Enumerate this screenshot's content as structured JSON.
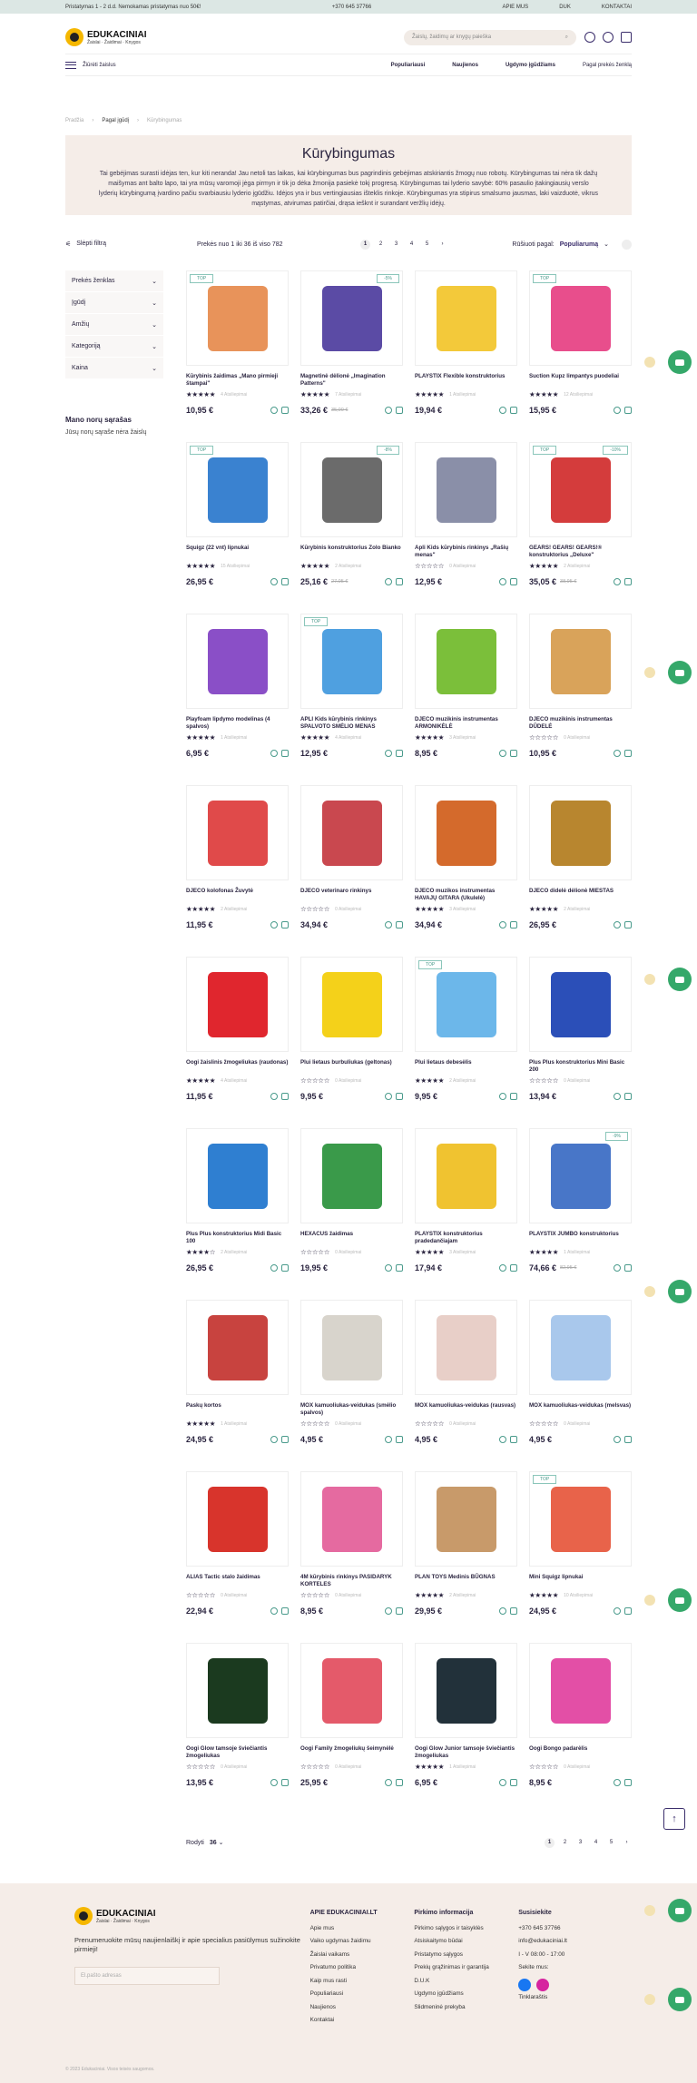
{
  "topbar": {
    "shipping": "Pristatymas 1 - 2 d.d. Nemokamas pristatymas nuo 50€!",
    "phone": "+370 645 37766",
    "links": [
      "APIE MUS",
      "DUK",
      "KONTAKTAI"
    ]
  },
  "brand": {
    "name": "EDUKACINIAI",
    "tagline": "Žaislai · Žaidimai · Knygos"
  },
  "search": {
    "placeholder": "Žaislų, žaidimų ar knygų paieška"
  },
  "nav": {
    "all": "Žiūrėti žaislus",
    "menu": [
      "Populiariausi",
      "Naujienos",
      "Ugdymo įgūdžiams",
      "Pagal prekės ženklą"
    ]
  },
  "breadcrumb": [
    "Pradžia",
    "Pagal įgūdį",
    "Kūrybingumas"
  ],
  "category": {
    "title": "Kūrybingumas",
    "description": "Tai gebėjimas surasti idėjas ten, kur kiti neranda! Jau netoli tas laikas, kai kūrybingumas bus pagrindinis gebėjimas atskiriantis žmogų nuo robotų. Kūrybingumas tai nėra tik dažų maišymas ant balto lapo, tai yra mūsų varomoji jėga pirmyn ir tik jo dėka žmonija pasiekė tokį progresą. Kūrybingumas tai lyderio savybė: 60% pasaulio įtakingiausių verslo lyderių kūrybingumą įvardino pačiu svarbiausiu lyderio įgūdžiu. Idėjos yra ir bus vertingiausias išteklis rinkoje. Kūrybingumas yra stipirus smalsumo jausmas, laki vaizduotė, vikrus mąstymas, atvirumas patirčiai, drąsa iešknt ir surandant veržlių idėjų."
  },
  "toolbar": {
    "hide": "Slėpti filtrą",
    "count": "Prekės nuo 1 iki 36 iš viso 782",
    "pages": [
      "1",
      "2",
      "3",
      "4",
      "5",
      "›"
    ],
    "sort_label": "Rūšiuoti pagal:",
    "sort_value": "Populiarumą"
  },
  "filters": [
    "Prekės ženklas",
    "Įgūdį",
    "Amžių",
    "Kategoriją",
    "Kaina"
  ],
  "wishlist": {
    "title": "Mano norų sąrašas",
    "text": "Jūsų norų sąraše nėra žaislų"
  },
  "products": [
    {
      "name": "Kūrybinis žaidimas „Mano pirmieji štampai\"",
      "stars": "★★★★★",
      "reviews": "4 Atsiliepimai",
      "price": "10,95 €",
      "old": "",
      "badge": "TOP",
      "color": "#e8935a"
    },
    {
      "name": "Magnetinė dėlionė „Imagination Patterns\"",
      "stars": "★★★★★",
      "reviews": "7 Atsiliepimai",
      "price": "33,26 €",
      "old": "35,00 €",
      "badge": "-5%",
      "color": "#5b4ba5"
    },
    {
      "name": "PLAYSTIX Flexible konstruktorius",
      "stars": "★★★★★",
      "reviews": "1 Atsiliepimai",
      "price": "19,94 €",
      "old": "",
      "badge": "",
      "color": "#f3c93a"
    },
    {
      "name": "Suction Kupz limpantys puodeliai",
      "stars": "★★★★★",
      "reviews": "12 Atsiliepimai",
      "price": "15,95 €",
      "old": "",
      "badge": "TOP",
      "color": "#e84e8c"
    },
    {
      "name": "Squigz (22 vnt) lipnukai",
      "stars": "★★★★★",
      "reviews": "15 Atsiliepimai",
      "price": "26,95 €",
      "old": "",
      "badge": "TOP",
      "color": "#3a82d0"
    },
    {
      "name": "Kūrybinis konstruktorius Zolo Bianko",
      "stars": "★★★★★",
      "reviews": "2 Atsiliepimai",
      "price": "25,16 €",
      "old": "27,05 €",
      "badge": "-8%",
      "color": "#6b6b6b"
    },
    {
      "name": "Apli Kids kūrybinis rinkinys „Rašių menas\"",
      "stars": "☆☆☆☆☆",
      "reviews": "0 Atsiliepimai",
      "price": "12,95 €",
      "old": "",
      "badge": "",
      "color": "#8a8fa8"
    },
    {
      "name": "GEARS! GEARS! GEARS!® konstruktorius „Deluxe\"",
      "stars": "★★★★★",
      "reviews": "2 Atsiliepimai",
      "price": "35,05 €",
      "old": "38,95 €",
      "badge": "TOP|-10%",
      "color": "#d43c3c"
    },
    {
      "name": "Playfoam lipdymo modelinas (4 spalvos)",
      "stars": "★★★★★",
      "reviews": "1 Atsiliepimai",
      "price": "6,95 €",
      "old": "",
      "badge": "",
      "color": "#8a4fc7"
    },
    {
      "name": "APLI Kids kūrybinis rinkinys SPALVOTO SMĖLIO MENAS",
      "stars": "★★★★★",
      "reviews": "4 Atsiliepimai",
      "price": "12,95 €",
      "old": "",
      "badge": "TOP",
      "color": "#4fa0e0"
    },
    {
      "name": "DJECO muzikinis instrumentas ARMONIKĖLĖ",
      "stars": "★★★★★",
      "reviews": "3 Atsiliepimai",
      "price": "8,95 €",
      "old": "",
      "badge": "",
      "color": "#7bbf3a"
    },
    {
      "name": "DJECO muzikinis instrumentas DŪDELĖ",
      "stars": "☆☆☆☆☆",
      "reviews": "0 Atsiliepimai",
      "price": "10,95 €",
      "old": "",
      "badge": "",
      "color": "#d9a35a"
    },
    {
      "name": "DJECO kolofonas Žuvytė",
      "stars": "★★★★★",
      "reviews": "2 Atsiliepimai",
      "price": "11,95 €",
      "old": "",
      "badge": "",
      "color": "#e04a4a"
    },
    {
      "name": "DJECO veterinaro rinkinys",
      "stars": "☆☆☆☆☆",
      "reviews": "0 Atsiliepimai",
      "price": "34,94 €",
      "old": "",
      "badge": "",
      "color": "#c9484f"
    },
    {
      "name": "DJECO muzikos instrumentas HAVAJŲ GITARA (Ukulelė)",
      "stars": "★★★★★",
      "reviews": "3 Atsiliepimai",
      "price": "34,94 €",
      "old": "",
      "badge": "",
      "color": "#d46a2c"
    },
    {
      "name": "DJECO didelė dėlionė MIESTAS",
      "stars": "★★★★★",
      "reviews": "2 Atsiliepimai",
      "price": "26,95 €",
      "old": "",
      "badge": "",
      "color": "#b8862f"
    },
    {
      "name": "Oogi žaislinis žmogeliukas (raudonas)",
      "stars": "★★★★★",
      "reviews": "4 Atsiliepimai",
      "price": "11,95 €",
      "old": "",
      "badge": "",
      "color": "#e0262e"
    },
    {
      "name": "Plui lietaus burbuliukas (geltonas)",
      "stars": "☆☆☆☆☆",
      "reviews": "0 Atsiliepimai",
      "price": "9,95 €",
      "old": "",
      "badge": "",
      "color": "#f4d11a"
    },
    {
      "name": "Plui lietaus debesėlis",
      "stars": "★★★★★",
      "reviews": "2 Atsiliepimai",
      "price": "9,95 €",
      "old": "",
      "badge": "TOP",
      "color": "#6cb7ea"
    },
    {
      "name": "Plus Plus konstruktorius Mini Basic 200",
      "stars": "☆☆☆☆☆",
      "reviews": "0 Atsiliepimai",
      "price": "13,94 €",
      "old": "",
      "badge": "",
      "color": "#2b4fb8"
    },
    {
      "name": "Plus Plus konstruktorius Midi Basic 100",
      "stars": "★★★★☆",
      "reviews": "2 Atsiliepimai",
      "price": "26,95 €",
      "old": "",
      "badge": "",
      "color": "#2f7fd1"
    },
    {
      "name": "HEXACUS žaidimas",
      "stars": "☆☆☆☆☆",
      "reviews": "0 Atsiliepimai",
      "price": "19,95 €",
      "old": "",
      "badge": "",
      "color": "#3a9a4a"
    },
    {
      "name": "PLAYSTIX konstruktorius pradedančiajam",
      "stars": "★★★★★",
      "reviews": "3 Atsiliepimai",
      "price": "17,94 €",
      "old": "",
      "badge": "",
      "color": "#f0c330"
    },
    {
      "name": "PLAYSTIX JUMBO konstruktorius",
      "stars": "★★★★★",
      "reviews": "1 Atsiliepimai",
      "price": "74,66 €",
      "old": "82,95 €",
      "badge": "-9%",
      "color": "#4876c8"
    },
    {
      "name": "Paskų kortos",
      "stars": "★★★★★",
      "reviews": "1 Atsiliepimai",
      "price": "24,95 €",
      "old": "",
      "badge": "",
      "color": "#c8433f"
    },
    {
      "name": "MOX kamuoliukas-veidukas (smėlio spalvos)",
      "stars": "☆☆☆☆☆",
      "reviews": "0 Atsiliepimai",
      "price": "4,95 €",
      "old": "",
      "badge": "",
      "color": "#d8d4cc"
    },
    {
      "name": "MOX kamuoliukas-veidukas (rausvas)",
      "stars": "☆☆☆☆☆",
      "reviews": "0 Atsiliepimai",
      "price": "4,95 €",
      "old": "",
      "badge": "",
      "color": "#e8cfc8"
    },
    {
      "name": "MOX kamuoliukas-veidukas (melsvas)",
      "stars": "☆☆☆☆☆",
      "reviews": "0 Atsiliepimai",
      "price": "4,95 €",
      "old": "",
      "badge": "",
      "color": "#a9c8ec"
    },
    {
      "name": "ALIAS Tactic stalo žaidimas",
      "stars": "☆☆☆☆☆",
      "reviews": "0 Atsiliepimai",
      "price": "22,94 €",
      "old": "",
      "badge": "",
      "color": "#d8342c"
    },
    {
      "name": "4M kūrybinis rinkinys PASIDARYK KORTELES",
      "stars": "☆☆☆☆☆",
      "reviews": "0 Atsiliepimai",
      "price": "8,95 €",
      "old": "",
      "badge": "",
      "color": "#e56aa0"
    },
    {
      "name": "PLAN TOYS Medinis BŪGNAS",
      "stars": "★★★★★",
      "reviews": "2 Atsiliepimai",
      "price": "29,95 €",
      "old": "",
      "badge": "",
      "color": "#c89a6a"
    },
    {
      "name": "Mini Squigz lipnukai",
      "stars": "★★★★★",
      "reviews": "10 Atsiliepimai",
      "price": "24,95 €",
      "old": "",
      "badge": "TOP",
      "color": "#e8634a"
    },
    {
      "name": "Oogi Glow tamsoje šviečiantis žmogeliukas",
      "stars": "☆☆☆☆☆",
      "reviews": "0 Atsiliepimai",
      "price": "13,95 €",
      "old": "",
      "badge": "",
      "color": "#1b3a1f"
    },
    {
      "name": "Oogi Family žmogeliukų šeimynėlė",
      "stars": "☆☆☆☆☆",
      "reviews": "0 Atsiliepimai",
      "price": "25,95 €",
      "old": "",
      "badge": "",
      "color": "#e45a6a"
    },
    {
      "name": "Oogi Glow Junior tamsoje šviečiantis žmogeliukas",
      "stars": "★★★★★",
      "reviews": "1 Atsiliepimai",
      "price": "6,95 €",
      "old": "",
      "badge": "",
      "color": "#22313a"
    },
    {
      "name": "Oogi Bongo padarėlis",
      "stars": "☆☆☆☆☆",
      "reviews": "0 Atsiliepimai",
      "price": "8,95 €",
      "old": "",
      "badge": "",
      "color": "#e34fa6"
    }
  ],
  "bottom": {
    "per_label": "Rodyti",
    "per_value": "36",
    "pages": [
      "1",
      "2",
      "3",
      "4",
      "5",
      "›"
    ]
  },
  "footer": {
    "newsletter": "Prenumeruokite mūsų naujienlaiškį ir apie specialius pasiūlymus sužinokite pirmieji!",
    "email_placeholder": "El.pašto adresas",
    "col1": {
      "title": "APIE EDUKACINIAI.LT",
      "items": [
        "Apie mus",
        "Vaiko ugdymas žaidimu",
        "Žaislai vaikams",
        "Privatumo politika",
        "Kaip mus rasti",
        "Populiariausi",
        "Naujienos",
        "Kontaktai"
      ]
    },
    "col2": {
      "title": "Pirkimo informacija",
      "items": [
        "Pirkimo sąlygos ir taisyklės",
        "Atsiskaitymo būdai",
        "Pristatymo sąlygos",
        "Prekių grąžinimas ir garantija",
        "D.U.K",
        "Ugdymo įgūdžiams",
        "Slidmeninė prekyba"
      ]
    },
    "col3": {
      "title": "Susisiekite",
      "items": [
        "+370 645 37766",
        "info@edukaciniai.lt",
        "I - V 08:00 - 17:00",
        "Sekite mus:"
      ],
      "social": "Tinklaraštis"
    },
    "copyright": "© 2023 Edukaciniai. Visos teisės saugomos."
  },
  "colors": {
    "accent": "#3a2d6b",
    "green": "#35a86a",
    "teal": "#4a9b8c",
    "beige": "#f5ede8"
  }
}
